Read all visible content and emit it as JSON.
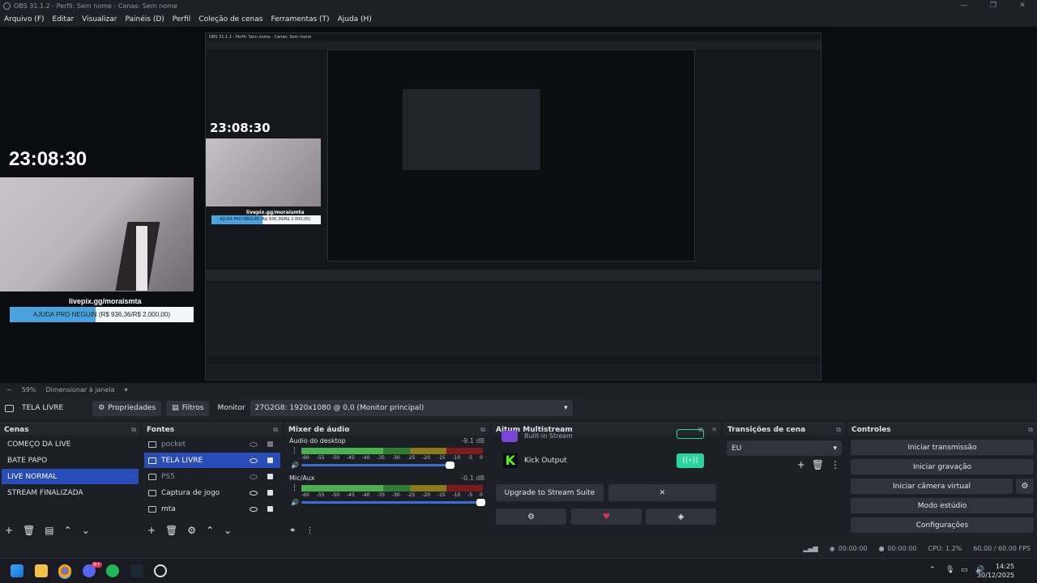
{
  "window": {
    "title": "OBS 31.1.2 - Perfil: Sem nome - Cenas: Sem nome",
    "controls": [
      "—",
      "❐",
      "✕"
    ]
  },
  "menu": [
    "Arquivo (F)",
    "Editar",
    "Visualizar",
    "Painéis (D)",
    "Perfil",
    "Coleção de cenas",
    "Ferramentas (T)",
    "Ajuda (H)"
  ],
  "preview": {
    "clock": "23:08:30",
    "donate_url": "livepix.gg/moraismta",
    "donate_text": "AJUDA PRO NEGUIN (R$ 936,36/R$ 2.000,00)",
    "donate_progress": 0.468,
    "nested_clock": "23:08:30",
    "nested_title": "OBS 31.1.2 - Perfil: Sem nome - Cenas: Sem nome",
    "nested_url": "livepix.gg/moraismta",
    "nested_donate": "AJUDA PRO NEGUIN (R$ 936,36/R$ 2.000,00)"
  },
  "zoom": {
    "minus": "−",
    "level": "59%",
    "mode": "Dimensionar à janela"
  },
  "source_bar": {
    "source_name": "TELA LIVRE",
    "properties": "Propriedades",
    "filters": "Filtros",
    "monitor_label": "Monitor",
    "monitor_value": "27G2G8: 1920x1080 @ 0,0 (Monitor principal)"
  },
  "scenes": {
    "title": "Cenas",
    "items": [
      "COMEÇO DA LIVE",
      "BATE PAPO",
      "LIVE NORMAL",
      "STREAM FINALIZADA"
    ],
    "selected": 2
  },
  "sources": {
    "title": "Fontes",
    "items": [
      {
        "name": "pocket",
        "icon": "camera"
      },
      {
        "name": "TELA LIVRE",
        "icon": "monitor"
      },
      {
        "name": "PS5",
        "icon": "camera"
      },
      {
        "name": "Captura de jogo",
        "icon": "gamepad"
      },
      {
        "name": "mta",
        "icon": "window"
      }
    ],
    "selected": 1
  },
  "mixer": {
    "title": "Mixer de áudio",
    "tracks": [
      {
        "name": "Áudio do desktop",
        "db": "-9.1 dB",
        "level": 0.82
      },
      {
        "name": "Mic/Aux",
        "db": "-0.1 dB",
        "level": 0.99
      }
    ],
    "ticks": [
      "-60",
      "-55",
      "-50",
      "-45",
      "-40",
      "-35",
      "-30",
      "-25",
      "-20",
      "-15",
      "-10",
      "-5",
      "0"
    ]
  },
  "multistream": {
    "title": "Aitum Multistream",
    "partial_label": "Built-in Stream",
    "output_name": "Kick Output",
    "upgrade": "Upgrade to Stream Suite",
    "close": "✕"
  },
  "transitions": {
    "title": "Transições de cena",
    "value": "EU"
  },
  "controls": {
    "title": "Controles",
    "buttons": [
      "Iniciar transmissão",
      "Iniciar gravação",
      "Iniciar câmera virtual",
      "Modo estúdio",
      "Configurações"
    ]
  },
  "status": {
    "stream_time": "00:00:00",
    "rec_time": "00:00:00",
    "cpu": "CPU: 1.2%",
    "fps": "60.00 / 60.00 FPS"
  },
  "taskbar": {
    "time": "14:25",
    "date": "30/12/2025",
    "discord_badge": "9+"
  },
  "colors": {
    "accent": "#284cb8",
    "kick": "#53fc18",
    "kick_toggle": "#2ad4a0",
    "heart": "#e0335b"
  }
}
